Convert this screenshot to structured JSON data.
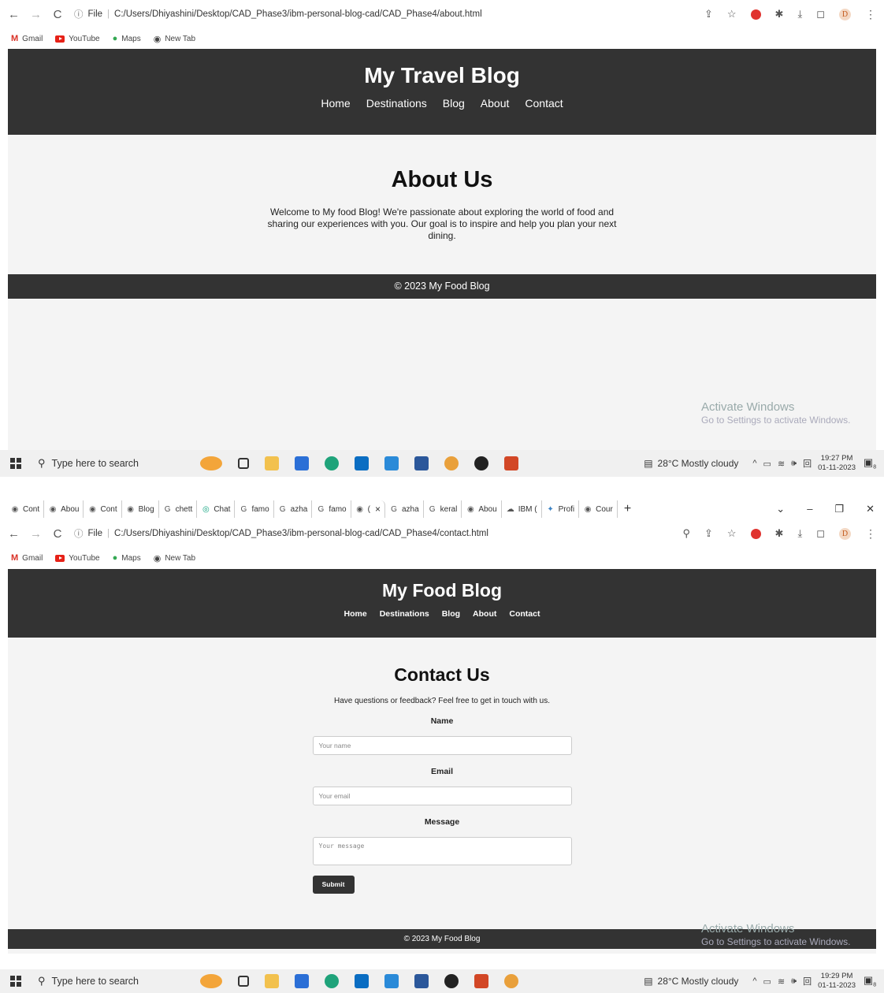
{
  "screens": [
    {
      "address": "C:/Users/Dhiyashini/Desktop/CAD_Phase3/ibm-personal-blog-cad/CAD_Phase4/about.html",
      "site_title": "My Travel Blog",
      "nav": [
        "Home",
        "Destinations",
        "Blog",
        "About",
        "Contact"
      ],
      "heading": "About Us",
      "body_lines": [
        "Welcome to My food Blog! We're passionate about exploring the world of food and",
        "sharing our experiences with you. Our goal is to inspire and help you plan your next",
        "dining."
      ],
      "footer": "© 2023 My Food Blog",
      "clock_time": "19:27 PM",
      "clock_date": "01-11-2023"
    },
    {
      "address": "C:/Users/Dhiyashini/Desktop/CAD_Phase3/ibm-personal-blog-cad/CAD_Phase4/contact.html",
      "site_title": "My Food Blog",
      "nav": [
        "Home",
        "Destinations",
        "Blog",
        "About",
        "Contact"
      ],
      "heading": "Contact Us",
      "intro": "Have questions or feedback? Feel free to get in touch with us.",
      "form": {
        "name_label": "Name",
        "name_placeholder": "Your name",
        "email_label": "Email",
        "email_placeholder": "Your email",
        "message_label": "Message",
        "message_placeholder": "Your message",
        "submit": "Submit"
      },
      "footer": "© 2023 My Food Blog",
      "clock_time": "19:29 PM",
      "clock_date": "01-11-2023"
    }
  ],
  "tabs": [
    "Cont",
    "Abou",
    "Cont",
    "Blog",
    "chett",
    "Chat",
    "famo",
    "azha",
    "famo",
    "(",
    "azha",
    "keral",
    "Abou",
    "IBM (",
    "Profi",
    "Cour"
  ],
  "file_label": "File",
  "bookmarks": [
    "Gmail",
    "YouTube",
    "Maps",
    "New Tab"
  ],
  "taskbar": {
    "search_placeholder": "Type here to search",
    "weather": "28°C  Mostly cloudy",
    "notif_count": "8"
  },
  "activate": {
    "title": "Activate Windows",
    "sub": "Go to Settings to activate Windows."
  }
}
